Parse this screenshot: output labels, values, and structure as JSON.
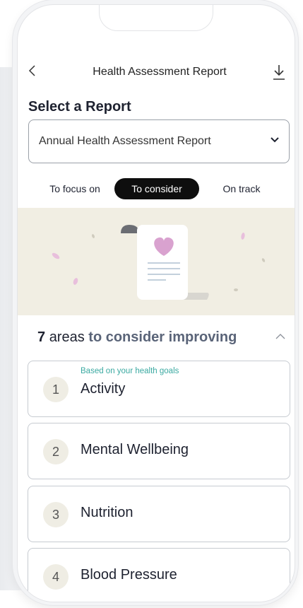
{
  "header": {
    "back_icon": "chevron-left-icon",
    "title": "Health Assessment Report",
    "download_icon": "download-icon"
  },
  "report_select": {
    "heading": "Select a Report",
    "value": "Annual Health Assessment Report",
    "icon": "chevron-down-icon"
  },
  "tabs": [
    {
      "label": "To focus on",
      "active": false
    },
    {
      "label": "To consider",
      "active": true
    },
    {
      "label": "On track",
      "active": false
    }
  ],
  "illustration": {
    "icon": "document-heart-icon",
    "accent_color": "#d9a2cf",
    "background_color": "#f1eee3"
  },
  "areas": {
    "count": "7",
    "text": "areas",
    "accent_text": "to consider improving",
    "collapse_icon": "chevron-up-icon"
  },
  "items": [
    {
      "number": "1",
      "label": "Activity",
      "hint": "Based on your health goals"
    },
    {
      "number": "2",
      "label": "Mental Wellbeing"
    },
    {
      "number": "3",
      "label": "Nutrition"
    },
    {
      "number": "4",
      "label": "Blood Pressure"
    }
  ]
}
